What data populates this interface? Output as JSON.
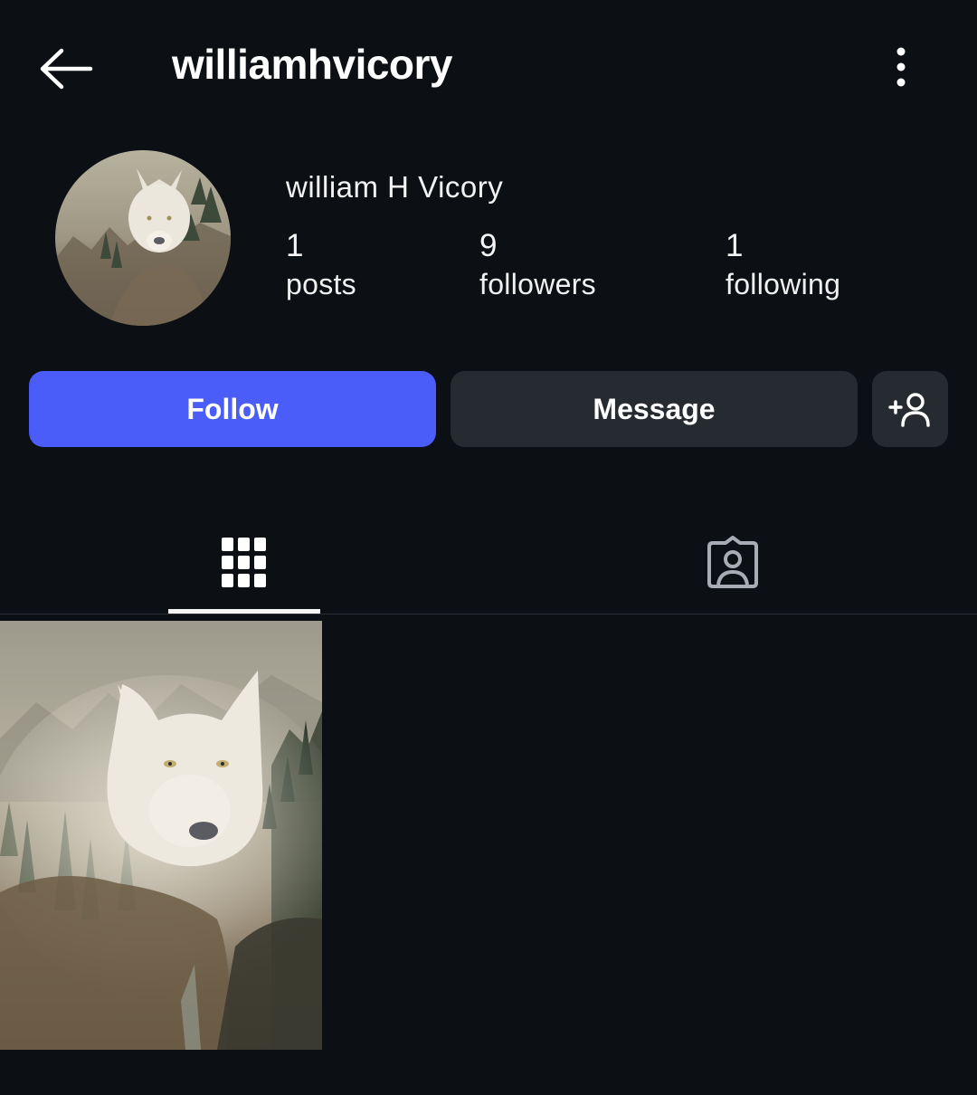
{
  "header": {
    "username": "williamhvicory",
    "back_icon": "arrow-left-icon",
    "more_icon": "more-vertical-icon"
  },
  "profile": {
    "display_name": "william H Vicory",
    "avatar_icon": "wolf-avatar",
    "stats": {
      "posts": {
        "count": "1",
        "label": "posts"
      },
      "followers": {
        "count": "9",
        "label": "followers"
      },
      "following": {
        "count": "1",
        "label": "following"
      }
    }
  },
  "actions": {
    "follow_label": "Follow",
    "message_label": "Message",
    "suggest_icon": "add-person-icon"
  },
  "tabs": {
    "grid_icon": "grid-icon",
    "tagged_icon": "tagged-person-icon",
    "active": "grid"
  },
  "posts": [
    {
      "image": "wolf-forest-painting"
    }
  ],
  "colors": {
    "background": "#0c1014",
    "follow_button": "#4a5df9",
    "secondary_button": "#262a31",
    "text": "#f5f5f5"
  }
}
